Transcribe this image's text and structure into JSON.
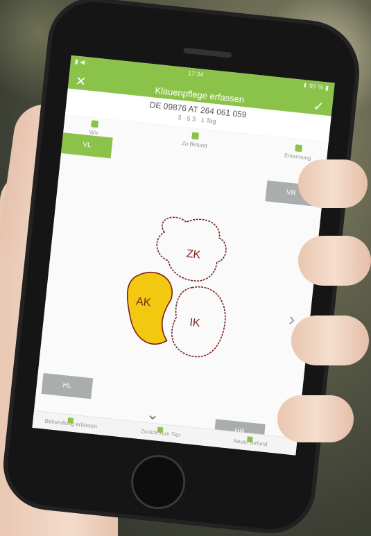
{
  "app": {
    "title": "Klauenpflege erfassen",
    "subtitle": "DE 09876 AT 264 061 059",
    "sub_info": "3 · 5      3 · 1 Tag",
    "status": {
      "time": "17:34",
      "left": "▮ ◀ ·",
      "right": "⬇ 97 % ▮"
    }
  },
  "tools": [
    {
      "label": "Wiz",
      "icon": "tool-icon"
    },
    {
      "label": "Zu Befund",
      "icon": "tool-icon"
    },
    {
      "label": "Erkennung",
      "icon": "tool-icon"
    }
  ],
  "quadrant_buttons": {
    "vl": "VL",
    "vr": "VR",
    "hl": "HL",
    "hr": "HR"
  },
  "udder": {
    "labels": {
      "zk": "ZK",
      "ak": "AK",
      "ik": "IK"
    },
    "highlight_color": "#f2c810",
    "outline_color": "#7a1f1f"
  },
  "nav": [
    {
      "label": "Behandlung erfassen"
    },
    {
      "label": "Zurück zum Tier"
    },
    {
      "label": "Neuer Befund"
    }
  ],
  "colors": {
    "accent": "#8bc34a",
    "button_grey": "#a9adad"
  }
}
